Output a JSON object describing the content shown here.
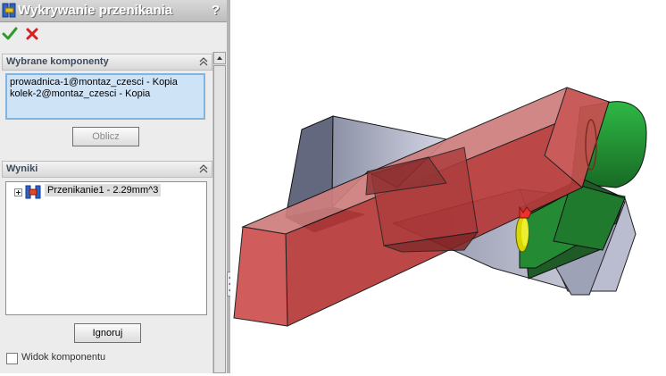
{
  "window": {
    "title": "Wykrywanie przenikania",
    "help": "?"
  },
  "actions": {
    "ok": "confirm-check",
    "cancel": "cancel-x"
  },
  "selected_group": {
    "title": "Wybrane komponenty",
    "items": [
      "prowadnica-1@montaz_czesci - Kopia",
      "kolek-2@montaz_czesci - Kopia"
    ],
    "calculate_button": "Oblicz"
  },
  "results_group": {
    "title": "Wyniki",
    "items": [
      {
        "label": "Przenikanie1 - 2.29mm^3"
      }
    ],
    "ignore_button": "Ignoruj"
  },
  "options": {
    "component_view_label": "Widok komponentu",
    "component_view_checked": false
  },
  "colors": {
    "interference": "#c03030",
    "pin": "#d8d800",
    "cylinder": "#2eaa3e",
    "body": "#a9adc3"
  }
}
